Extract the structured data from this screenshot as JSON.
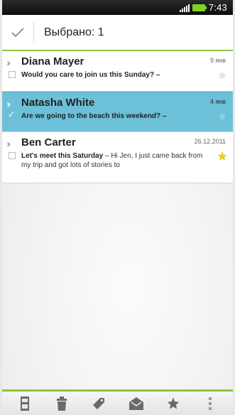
{
  "status_bar": {
    "time": "7:43"
  },
  "header": {
    "title": "Выбрано: 1"
  },
  "emails": [
    {
      "sender": "Diana Mayer",
      "date": "9 янв",
      "subject": "Would you care to join us this Sunday? –",
      "preview": "",
      "selected": false,
      "starred": false
    },
    {
      "sender": "Natasha White",
      "date": "4 янв",
      "subject": "Are we going to the beach this weekend? –",
      "preview": "",
      "selected": true,
      "starred": false
    },
    {
      "sender": "Ben Carter",
      "date": "26.12.2011",
      "subject": "Let's meet this Saturday",
      "preview": " – Hi Jen, I just came back from my trip and got lots of stories to",
      "selected": false,
      "starred": true
    }
  ],
  "bottom_bar": {
    "actions": [
      "move-icon",
      "delete-icon",
      "label-icon",
      "mark-read-icon",
      "star-icon",
      "more-icon"
    ]
  },
  "colors": {
    "accent": "#8cc63f",
    "selected_row": "#6cc0d8",
    "star": "#f5d31f"
  }
}
